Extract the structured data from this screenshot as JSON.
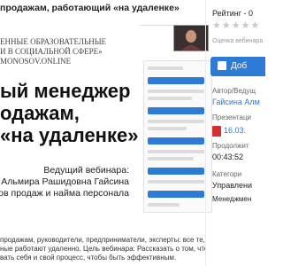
{
  "page_title": "продажам, работающий «на удаленке»",
  "slide": {
    "org_line1": "ЕННЫЕ ОБРАЗОВАТЕЛЬНЫЕ",
    "org_line2": "И В СОЦИАЛЬНОЙ СФЕРЕ»",
    "org_line3": "MONOSOV.ONLINE",
    "headline_line1": "ый менеджер",
    "headline_line2": "одажам,",
    "headline_line3": "«на удаленке»",
    "speaker_line1": "Ведущий вебинара:",
    "speaker_line2": "Альмира Рашидовна Гайсина",
    "speaker_line3": "отделов продаж и найма персонала"
  },
  "sidebar": {
    "rating_label": "Рейтинг - 0",
    "stars": "★★★★★",
    "rating_sub": "Оценка вебинара",
    "add_button": "Доб",
    "author_label": "Автор/Ведущ",
    "author_name": "Гайсина Алм",
    "presentation_label": "Презентаци",
    "presentation_file": "16.03.",
    "duration_label": "Продолжит",
    "duration": "00:43:52",
    "category_label": "Категори",
    "category_value": "Управлени",
    "tag_value": "Менеджмен"
  },
  "description": {
    "line1": "продажам, руководители, предприниматели, эксперты: все те, кто продает, в том",
    "line2": "ные работают удаленно. Цель вебинара: Рассказать о том, что значит быть",
    "line3": "вать себя и свой процесс, чтобы быть эффективным."
  }
}
